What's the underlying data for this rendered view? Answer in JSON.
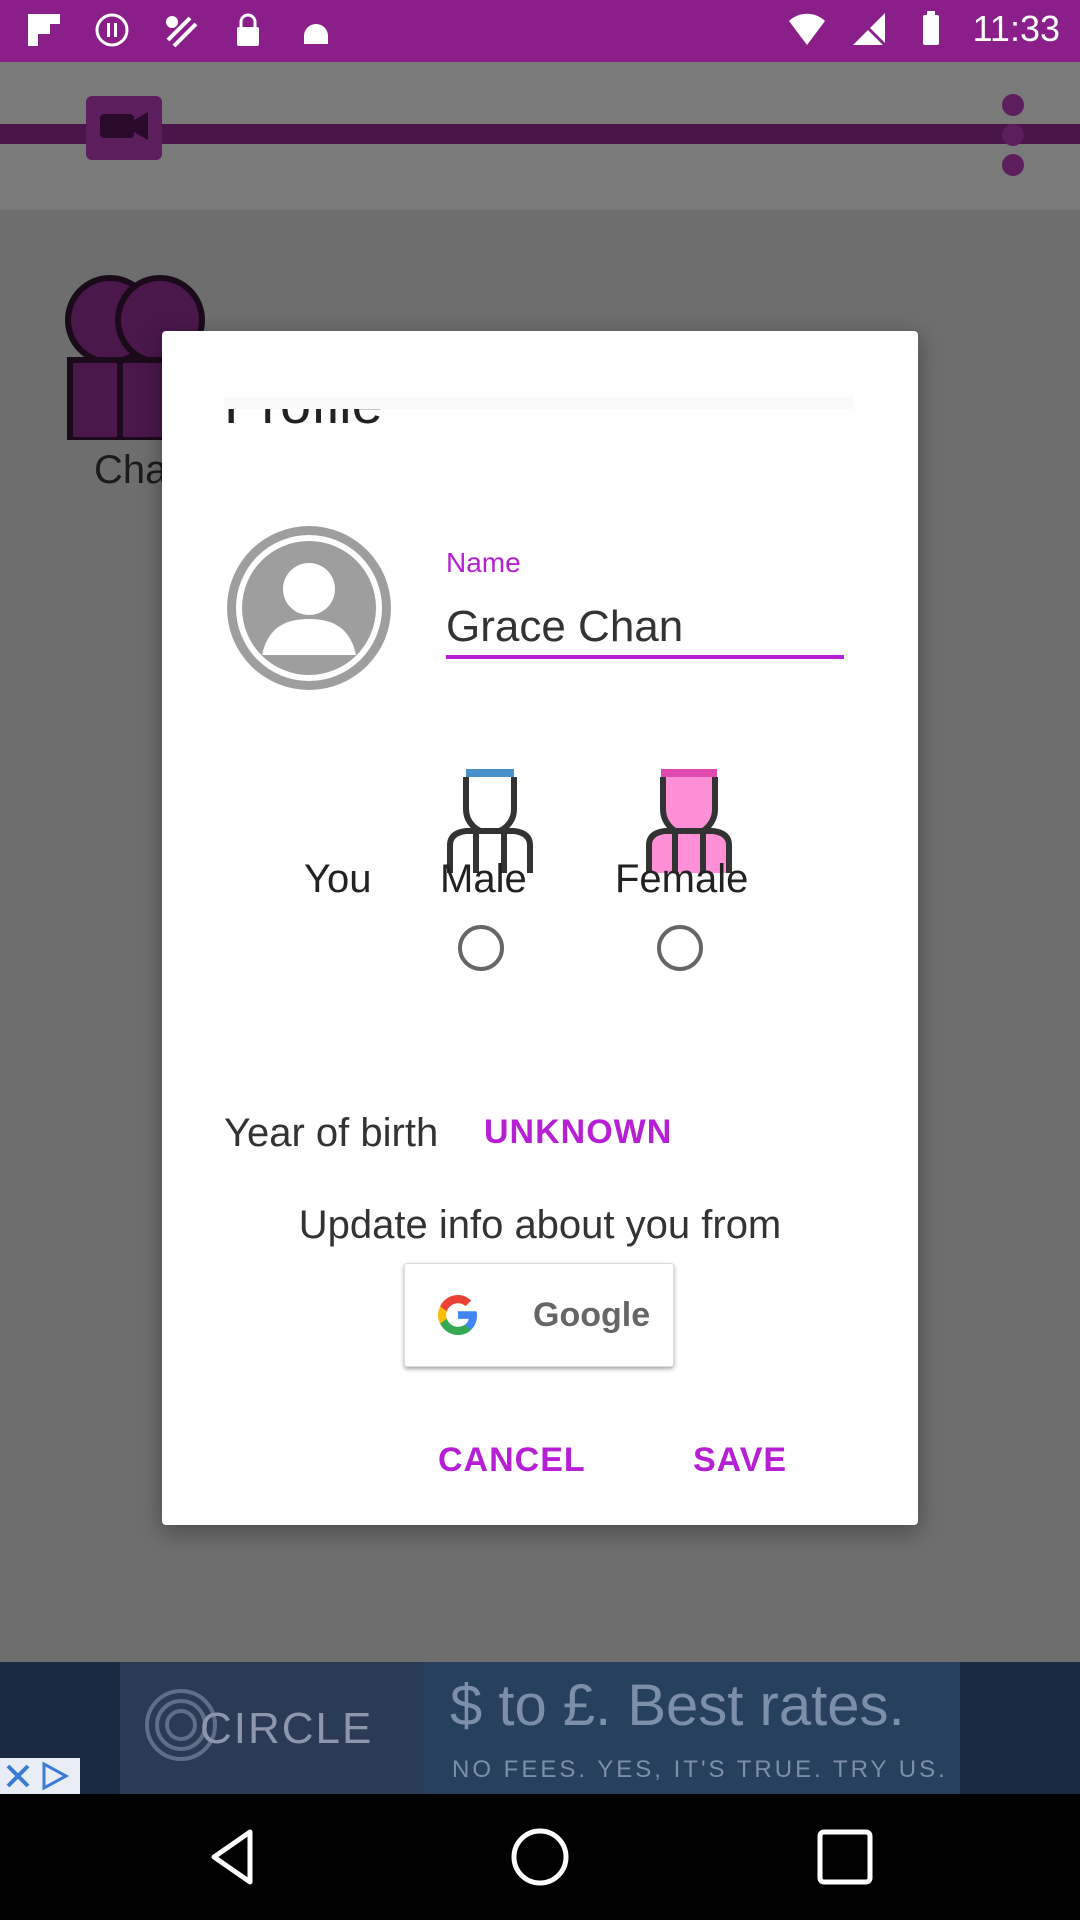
{
  "status_bar": {
    "time": "11:33",
    "left_icons": [
      "flipboard-icon",
      "record-icon",
      "fake-gps-icon",
      "lock-icon",
      "android-icon"
    ],
    "right_icons": [
      "wifi-icon",
      "no-sim-icon",
      "battery-icon"
    ]
  },
  "background_app": {
    "menu_icon": "overflow-menu-icon",
    "logo_icon": "video-chat-icon",
    "partial_label": "Cha"
  },
  "dialog": {
    "title": "Profile",
    "name_label": "Name",
    "name_value": "Grace Chan",
    "you_label": "You",
    "gender_options": [
      {
        "label": "Male",
        "selected": false
      },
      {
        "label": "Female",
        "selected": false
      }
    ],
    "year_of_birth_label": "Year of birth",
    "year_of_birth_value": "UNKNOWN",
    "update_text": "Update info about you from",
    "google_button_label": "Google",
    "cancel_label": "CANCEL",
    "save_label": "SAVE",
    "accent_color": "#b61fd4"
  },
  "ad": {
    "brand": "CIRCLE",
    "headline": "$ to £. Best rates.",
    "subline": "NO FEES. YES, IT'S TRUE. TRY US."
  },
  "nav_bar": {
    "icons": [
      "back-icon",
      "home-icon",
      "recents-icon"
    ]
  }
}
